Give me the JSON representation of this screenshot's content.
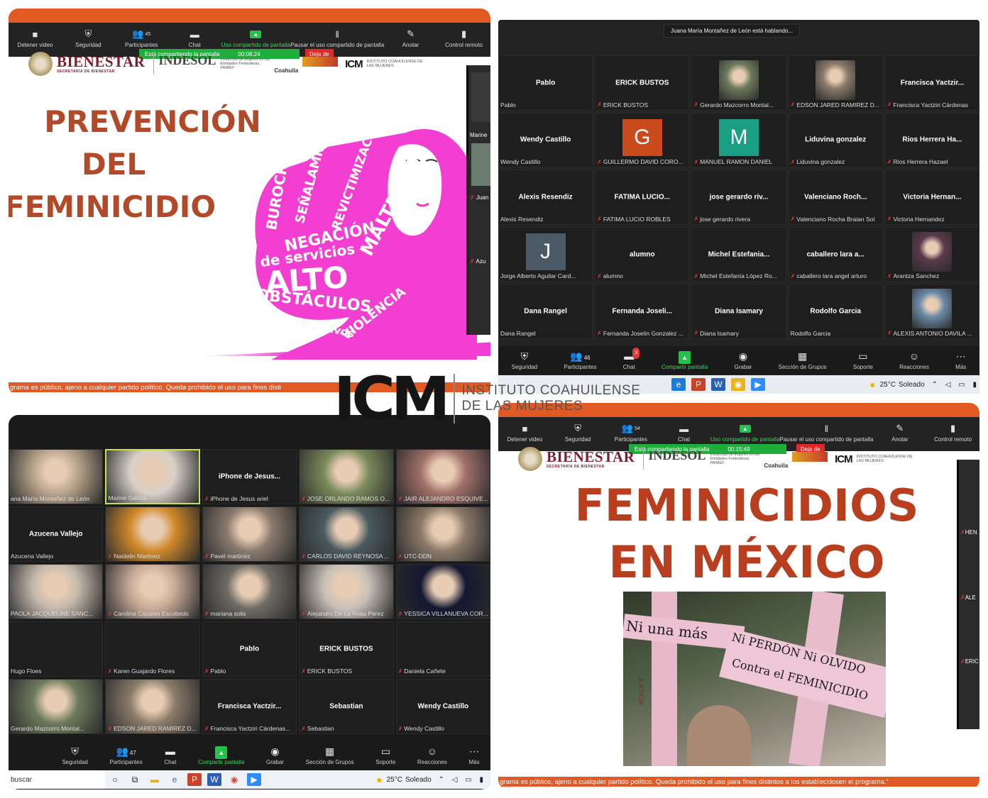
{
  "p1": {
    "toolbar": [
      {
        "label": "Detener video",
        "icon": "video-icon"
      },
      {
        "label": "Seguridad",
        "icon": "shield-icon"
      },
      {
        "label": "Participantes",
        "icon": "participants-icon",
        "count": "45"
      },
      {
        "label": "Chat",
        "icon": "chat-icon"
      },
      {
        "label": "Uso compartido de pantalla",
        "icon": "share-icon"
      },
      {
        "label": "Pausar el uso compartido de pantalla",
        "icon": "pause-icon"
      },
      {
        "label": "Anotar",
        "icon": "pen-icon"
      },
      {
        "label": "Control remoto",
        "icon": "mouse-icon"
      }
    ],
    "sharing_text": "Está compartiendo la pantalla",
    "sharing_time": "00:08:24",
    "stop_label": "Deja de",
    "bienestar": "BIENESTAR",
    "bienestar_sub": "SECRETARÍA DE BIENESTAR",
    "indesol": "INDESOL",
    "instancias": "Instancias de Mujeres en las Entidades Federativas, PAIMEF",
    "coahuila": "Coahuila",
    "icm": "ICM",
    "icm_sub": "INSTITUTO COAHUILENSE DE LAS MUJERES",
    "title_lines": [
      "PREVENCIÓN",
      "DEL",
      "FEMINICIDIO"
    ],
    "word_cloud": [
      "BUROCRACIA",
      "SEÑALAMIENTO",
      "REVICTIMIZACIÓN",
      "MALTRATO",
      "NEGACIÓN",
      "de servicios",
      "ALTO",
      "OBSTÁCULOS",
      "VIOLENCIA",
      "administrativos"
    ],
    "side_names": [
      "Marine",
      "Juan",
      "Azu"
    ],
    "footer": "grama es público, ajeno a cualquier partido político. Queda prohibido el uso para fines disti"
  },
  "p2": {
    "speaking": "Juana María Montañez de León está hablando...",
    "tiles": [
      {
        "name": "Pablo",
        "label": "Pablo",
        "muted": false
      },
      {
        "name": "ERICK BUSTOS",
        "label": "ERICK BUSTOS",
        "muted": true
      },
      {
        "name": "",
        "label": "Gerardo Mazcorro Montal...",
        "muted": true,
        "photo": "#6d7a5c"
      },
      {
        "name": "",
        "label": "EDSON JARED RAMIREZ D...",
        "muted": true,
        "photo": "#8b7b6a"
      },
      {
        "name": "Francisca Yactzir...",
        "label": "Francisca Yactziri Cárdenas",
        "muted": true
      },
      {
        "name": "Wendy Castillo",
        "label": "Wendy Castillo",
        "muted": false
      },
      {
        "name": "",
        "label": "GUILLERMO DAVID CORO...",
        "muted": true,
        "letter": "G",
        "letter_color": "#c94a1c"
      },
      {
        "name": "",
        "label": "MANUEL RAMON DANIEL",
        "muted": true,
        "letter": "M",
        "letter_color": "#1a9e84"
      },
      {
        "name": "Liduvina gonzalez",
        "label": "Liduvina gonzalez",
        "muted": true
      },
      {
        "name": "Rios Herrera Ha...",
        "label": "Rios Herrera Hazael",
        "muted": true
      },
      {
        "name": "Alexis Resendiz",
        "label": "Alexis Resendiz",
        "muted": false
      },
      {
        "name": "FATIMA LUCIO...",
        "label": "FATIMA LUCIO ROBLES",
        "muted": true
      },
      {
        "name": "jose gerardo riv...",
        "label": "jose gerardo rivera",
        "muted": true
      },
      {
        "name": "Valenciano Roch...",
        "label": "Valenciano Rocha Braian Sol",
        "muted": true
      },
      {
        "name": "Victoria Hernan...",
        "label": "Victoria Hernandez",
        "muted": true
      },
      {
        "name": "",
        "label": "Jorge Alberto Aguilar Card...",
        "muted": false,
        "letter": "J",
        "letter_color": "#4b5a66"
      },
      {
        "name": "alumno",
        "label": "alumno",
        "muted": true
      },
      {
        "name": "Michel Estefania...",
        "label": "Michel Estefanía López Ro...",
        "muted": true
      },
      {
        "name": "caballero lara a...",
        "label": "caballero lara angel arturo",
        "muted": true
      },
      {
        "name": "",
        "label": "Arantza Sanchez",
        "muted": true,
        "photo": "#5a3a4a"
      },
      {
        "name": "Dana Rangel",
        "label": "Dana Rangel",
        "muted": false
      },
      {
        "name": "Fernanda Joseli...",
        "label": "Fernanda Joselin Gonzalez ...",
        "muted": true
      },
      {
        "name": "Diana Isamary",
        "label": "Diana Isamary",
        "muted": true
      },
      {
        "name": "Rodolfo Garcia",
        "label": "Rodolfo Garcia",
        "muted": false
      },
      {
        "name": "",
        "label": "ALEXIS ANTONIO DAVILA ...",
        "muted": true,
        "photo": "#6b8aa6"
      }
    ],
    "toolbar": [
      {
        "label": "Seguridad",
        "icon": "shield-icon"
      },
      {
        "label": "Participantes",
        "icon": "participants-icon",
        "count": "46"
      },
      {
        "label": "Chat",
        "icon": "chat-icon",
        "badge": "3"
      },
      {
        "label": "Compartir pantalla",
        "icon": "share-icon"
      },
      {
        "label": "Grabar",
        "icon": "record-icon"
      },
      {
        "label": "Sección de Grupos",
        "icon": "grid-icon"
      },
      {
        "label": "Soporte",
        "icon": "support-icon"
      },
      {
        "label": "Reacciones",
        "icon": "smiley-icon"
      },
      {
        "label": "Más",
        "icon": "more-icon"
      }
    ],
    "weather": "25°C",
    "weather_desc": "Soleado"
  },
  "p3": {
    "tiles": [
      {
        "name": "",
        "label": "ana María Montañez de León",
        "muted": false,
        "photo": "#b8a48c"
      },
      {
        "name": "",
        "label": "Marine Garcia",
        "muted": false,
        "photo": "#d8d0c8",
        "highlight": true
      },
      {
        "name": "iPhone de Jesus...",
        "label": "iPhone de Jesus ariel",
        "muted": true
      },
      {
        "name": "",
        "label": "JOSE ORLANDO RAMOS O...",
        "muted": true,
        "photo": "#7a8a5a"
      },
      {
        "name": "",
        "label": "JAIR ALEJANDRO ESQUIVE...",
        "muted": true,
        "photo": "#a0706a"
      },
      {
        "name": "Azucena Vallejo",
        "label": "Azucena Vallejo",
        "muted": false
      },
      {
        "name": "",
        "label": "Naidelin Martinez",
        "muted": true,
        "photo": "#d08a2a"
      },
      {
        "name": "",
        "label": "Pavel martinez",
        "muted": true,
        "photo": "#8a7a6e"
      },
      {
        "name": "",
        "label": "CARLOS DAVID REYNOSA ...",
        "muted": true,
        "photo": "#4a5a5e"
      },
      {
        "name": "",
        "label": "UTC-DDN",
        "muted": true,
        "photo": "#8c7a6a"
      },
      {
        "name": "",
        "label": "PAOLA JACQUELINE SANC...",
        "muted": false,
        "photo": "#c4b8ac"
      },
      {
        "name": "",
        "label": "Carolina Cázares Escobedo",
        "muted": true,
        "photo": "#c8aa98"
      },
      {
        "name": "",
        "label": "mariana solis",
        "muted": true,
        "photo": "#6e6a64"
      },
      {
        "name": "",
        "label": "Alejandro De La Rosa Perez",
        "muted": true,
        "photo": "#c8c0b8"
      },
      {
        "name": "",
        "label": "YESSICA VILLANUEVA COR...",
        "muted": true,
        "photo": "#141830"
      },
      {
        "name": "",
        "label": "Hugo Floes",
        "muted": false
      },
      {
        "name": "",
        "label": "Karen Guajardo Flores",
        "muted": true
      },
      {
        "name": "Pablo",
        "label": "Pablo",
        "muted": true
      },
      {
        "name": "ERICK BUSTOS",
        "label": "ERICK BUSTOS",
        "muted": true
      },
      {
        "name": "",
        "label": "Daniela Cañete",
        "muted": true
      },
      {
        "name": "",
        "label": "Gerardo Mazcorro Montal...",
        "muted": false,
        "photo": "#6d7a5c"
      },
      {
        "name": "",
        "label": "EDSON JARED RAMIREZ D...",
        "muted": true,
        "photo": "#8b7b6a"
      },
      {
        "name": "Francisca Yactzir...",
        "label": "Francisca Yactziri Cárdenas...",
        "muted": true
      },
      {
        "name": "Sebastian",
        "label": "Sebastian",
        "muted": true
      },
      {
        "name": "Wendy Castillo",
        "label": "Wendy Castillo",
        "muted": true
      }
    ],
    "toolbar": [
      {
        "label": "Seguridad",
        "icon": "shield-icon"
      },
      {
        "label": "Participantes",
        "icon": "participants-icon",
        "count": "47"
      },
      {
        "label": "Chat",
        "icon": "chat-icon"
      },
      {
        "label": "Compartir pantalla",
        "icon": "share-icon"
      },
      {
        "label": "Grabar",
        "icon": "record-icon"
      },
      {
        "label": "Sección de Grupos",
        "icon": "grid-icon"
      },
      {
        "label": "Soporte",
        "icon": "support-icon"
      },
      {
        "label": "Reacciones",
        "icon": "smiley-icon"
      },
      {
        "label": "Más",
        "icon": "more-icon"
      }
    ],
    "search": "buscar",
    "weather": "25°C",
    "weather_desc": "Soleado"
  },
  "p4": {
    "toolbar": [
      {
        "label": "Detener video",
        "icon": "video-icon"
      },
      {
        "label": "Seguridad",
        "icon": "shield-icon"
      },
      {
        "label": "Participantes",
        "icon": "participants-icon",
        "count": "54"
      },
      {
        "label": "Chat",
        "icon": "chat-icon"
      },
      {
        "label": "Uso compartido de pantalla",
        "icon": "share-icon"
      },
      {
        "label": "Pausar el uso compartido de pantalla",
        "icon": "pause-icon"
      },
      {
        "label": "Anotar",
        "icon": "pen-icon"
      },
      {
        "label": "Control remoto",
        "icon": "mouse-icon"
      }
    ],
    "sharing_text": "Está compartiendo la pantalla",
    "sharing_time": "00:15:49",
    "stop_label": "Deja de",
    "title_lines": [
      "FEMINICIDIOS",
      "EN MÉXICO"
    ],
    "cross_texts": [
      "Ni una más",
      "Ni PERDÓN Ni OLVIDO",
      "Contra el FEMINICIDIO",
      "JUSTICIA"
    ],
    "side_names": [
      "HEN",
      "ALE",
      "ERIC"
    ],
    "footer": "grama es público, ajeno a cualquier partido político. Queda prohibido el uso para fines distintos a los establecidosen el programa.\""
  },
  "overlay": {
    "icm": "ICM",
    "line1": "INSTITUTO COAHUILENSE",
    "line2": "DE LAS MUJERES"
  },
  "colors": {
    "orange": "#e15a24",
    "zoom_dark": "#232323",
    "slide_title": "#b14a28",
    "magenta": "#f23fd2",
    "green_share": "#26c04b"
  }
}
